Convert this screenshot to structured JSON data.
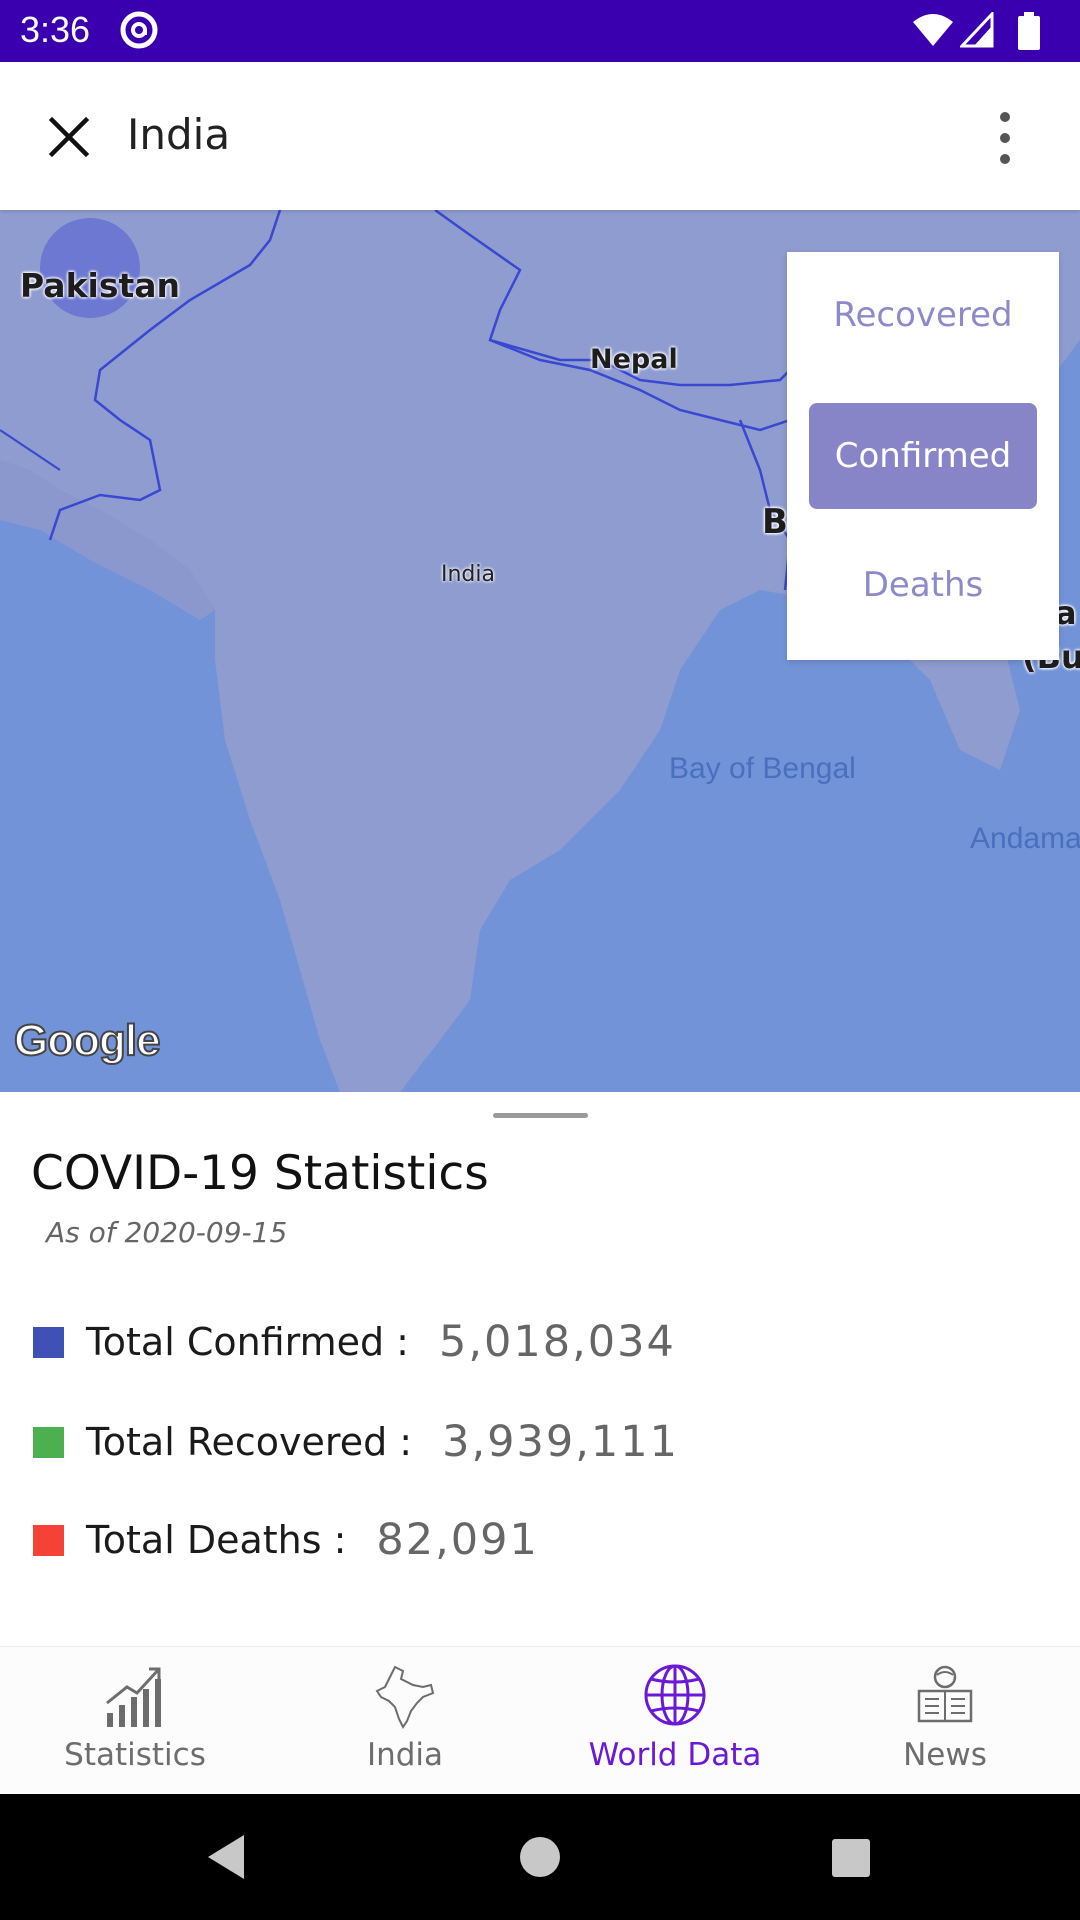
{
  "status_bar": {
    "time": "3:36",
    "icons": [
      "at-sign-icon",
      "wifi-icon",
      "cell-signal-icon",
      "battery-icon"
    ],
    "background": "#3a00b0"
  },
  "toolbar": {
    "title": "India",
    "close_icon": "close-icon",
    "overflow_icon": "more-vert-icon"
  },
  "map": {
    "labels": {
      "pakistan": "Pakistan",
      "nepal": "Nepal",
      "india": "India",
      "bay_of_bengal": "Bay of Bengal",
      "andaman_partial": "Andama",
      "bangladesh_partial": "B",
      "myanmar_partial_1": "a",
      "myanmar_partial_2": "(Bu"
    },
    "attribution": "Google",
    "water_color": "#7393d8",
    "land_color": "#8f9cd0"
  },
  "popup_menu": {
    "items": [
      {
        "label": "Recovered",
        "selected": false
      },
      {
        "label": "Confirmed",
        "selected": true
      },
      {
        "label": "Deaths",
        "selected": false
      }
    ]
  },
  "stats": {
    "title": "COVID-19 Statistics",
    "as_of": "As of 2020-09-15",
    "rows": [
      {
        "label": "Total Confirmed :",
        "value": "5,018,034",
        "color": "#3f51b5"
      },
      {
        "label": "Total Recovered :",
        "value": "3,939,111",
        "color": "#4caf50"
      },
      {
        "label": "Total Deaths :",
        "value": "82,091",
        "color": "#f44336"
      }
    ]
  },
  "bottom_nav": {
    "items": [
      {
        "label": "Statistics",
        "icon": "chart-icon",
        "active": false
      },
      {
        "label": "India",
        "icon": "india-map-icon",
        "active": false
      },
      {
        "label": "World Data",
        "icon": "globe-icon",
        "active": true
      },
      {
        "label": "News",
        "icon": "newspaper-reader-icon",
        "active": false
      }
    ],
    "active_color": "#6a1ad6"
  }
}
